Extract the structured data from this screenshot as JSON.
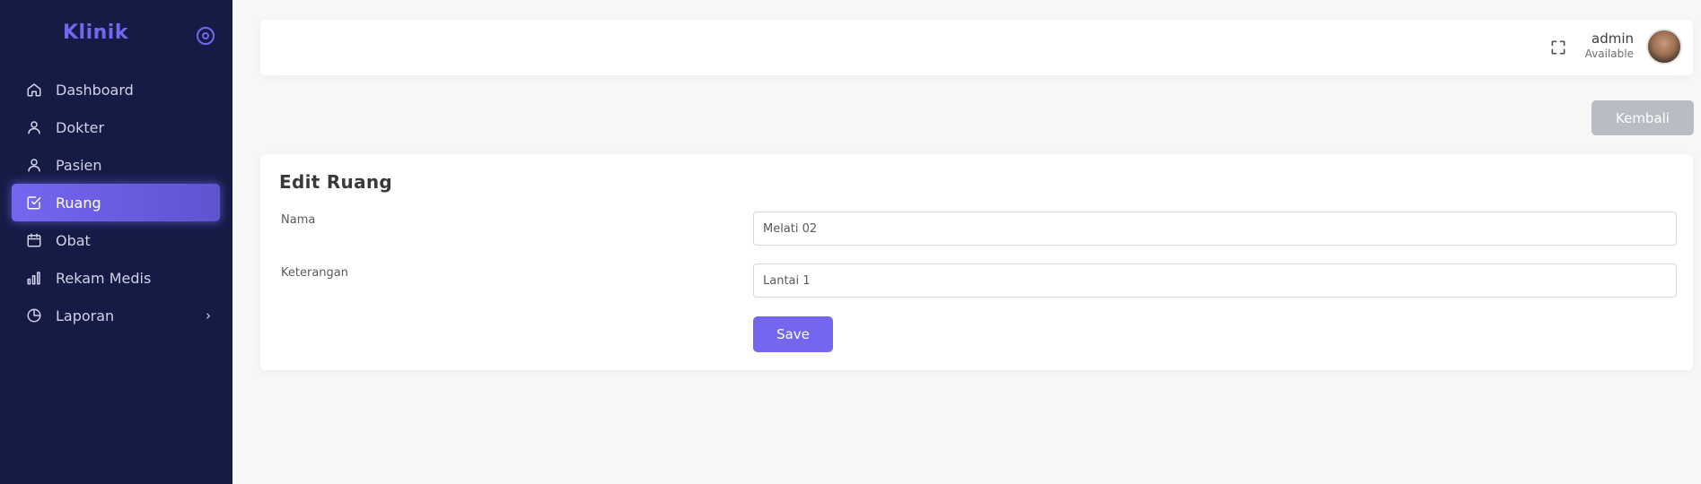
{
  "brand": {
    "title": "Klinik"
  },
  "sidebar": {
    "items": [
      {
        "label": "Dashboard",
        "icon": "home-icon"
      },
      {
        "label": "Dokter",
        "icon": "user-icon"
      },
      {
        "label": "Pasien",
        "icon": "user-icon"
      },
      {
        "label": "Ruang",
        "icon": "check-square-icon",
        "active": true
      },
      {
        "label": "Obat",
        "icon": "calendar-icon"
      },
      {
        "label": "Rekam Medis",
        "icon": "bar-chart-icon"
      },
      {
        "label": "Laporan",
        "icon": "pie-chart-icon",
        "has_submenu": true
      }
    ]
  },
  "header": {
    "user_name": "admin",
    "user_status": "Available"
  },
  "actions": {
    "back_label": "Kembali"
  },
  "form": {
    "title": "Edit Ruang",
    "fields": [
      {
        "label": "Nama",
        "value": "Melati 02"
      },
      {
        "label": "Keterangan",
        "value": "Lantai 1"
      }
    ],
    "save_label": "Save"
  },
  "colors": {
    "sidebar_bg": "#161b46",
    "accent": "#7367f0",
    "back_button": "#b9bcc5",
    "page_bg": "#f7f7f7"
  }
}
